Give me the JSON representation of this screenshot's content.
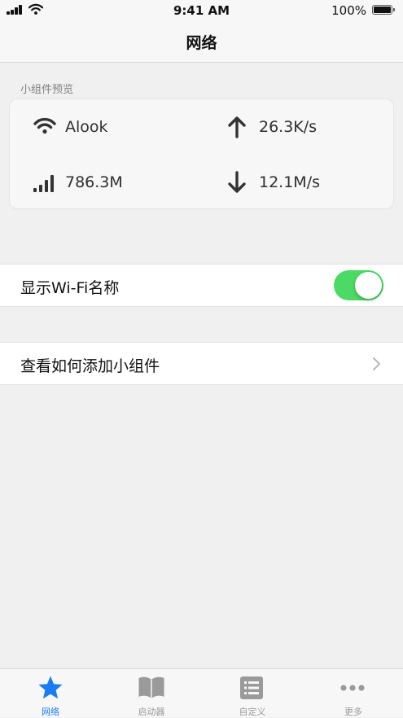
{
  "status_bar": {
    "time": "9:41 AM",
    "battery": "100%"
  },
  "nav": {
    "title": "网络"
  },
  "widget_preview": {
    "header": "小组件预览",
    "wifi_name": "Alook",
    "upload_speed": "26.3K/s",
    "data_usage": "786.3M",
    "download_speed": "12.1M/s"
  },
  "settings": {
    "show_wifi_name_label": "显示Wi-Fi名称",
    "show_wifi_name_on": true,
    "how_to_add_label": "查看如何添加小组件"
  },
  "tabs": [
    {
      "label": "网络",
      "icon": "star-icon",
      "active": true
    },
    {
      "label": "启动器",
      "icon": "book-icon",
      "active": false
    },
    {
      "label": "自定义",
      "icon": "list-icon",
      "active": false
    },
    {
      "label": "更多",
      "icon": "more-icon",
      "active": false
    }
  ],
  "colors": {
    "accent": "#1a7cf2",
    "toggle_on": "#4cd964",
    "inactive_tab": "#9a9a9a"
  }
}
